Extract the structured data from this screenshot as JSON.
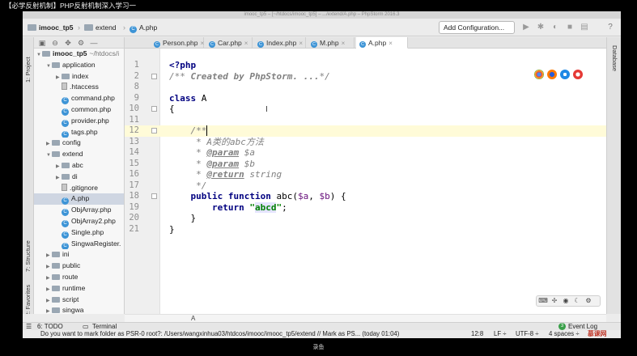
{
  "video": {
    "title": "【必学反射机制】PHP反射机制深入学习一",
    "watermark": "录鱼"
  },
  "window": {
    "mac_title": "imooc_tp5 – [~/htdocs/imooc_tp5] – .../extend/A.php – PhpStorm 2016.3"
  },
  "navbar": {
    "crumbs": [
      "imooc_tp5",
      "extend",
      "A.php"
    ],
    "run_config": "Add Configuration..."
  },
  "side_tabs": {
    "project": "1: Project",
    "structure": "7: Structure",
    "favorites": "2: Favorites",
    "database": "Database"
  },
  "project_tree": [
    {
      "indent": 0,
      "arrow": "▼",
      "icon": "folder",
      "label": "imooc_tp5",
      "suffix": "~/htdocs/i"
    },
    {
      "indent": 1,
      "arrow": "▼",
      "icon": "folder",
      "label": "application",
      "suffix": ""
    },
    {
      "indent": 2,
      "arrow": "▶",
      "icon": "folder",
      "label": "index",
      "suffix": ""
    },
    {
      "indent": 2,
      "arrow": "",
      "icon": "file",
      "label": ".htaccess",
      "suffix": ""
    },
    {
      "indent": 2,
      "arrow": "",
      "icon": "php",
      "label": "command.php",
      "suffix": ""
    },
    {
      "indent": 2,
      "arrow": "",
      "icon": "php",
      "label": "common.php",
      "suffix": ""
    },
    {
      "indent": 2,
      "arrow": "",
      "icon": "php",
      "label": "provider.php",
      "suffix": ""
    },
    {
      "indent": 2,
      "arrow": "",
      "icon": "php",
      "label": "tags.php",
      "suffix": ""
    },
    {
      "indent": 1,
      "arrow": "▶",
      "icon": "folder",
      "label": "config",
      "suffix": ""
    },
    {
      "indent": 1,
      "arrow": "▼",
      "icon": "folder",
      "label": "extend",
      "suffix": ""
    },
    {
      "indent": 2,
      "arrow": "▶",
      "icon": "folder",
      "label": "abc",
      "suffix": ""
    },
    {
      "indent": 2,
      "arrow": "▶",
      "icon": "folder",
      "label": "di",
      "suffix": ""
    },
    {
      "indent": 2,
      "arrow": "",
      "icon": "file",
      "label": ".gitignore",
      "suffix": ""
    },
    {
      "indent": 2,
      "arrow": "",
      "icon": "php",
      "label": "A.php",
      "suffix": "",
      "selected": true
    },
    {
      "indent": 2,
      "arrow": "",
      "icon": "php",
      "label": "ObjArray.php",
      "suffix": ""
    },
    {
      "indent": 2,
      "arrow": "",
      "icon": "php",
      "label": "ObjArray2.php",
      "suffix": ""
    },
    {
      "indent": 2,
      "arrow": "",
      "icon": "php",
      "label": "Single.php",
      "suffix": ""
    },
    {
      "indent": 2,
      "arrow": "",
      "icon": "php",
      "label": "SingwaRegister.",
      "suffix": ""
    },
    {
      "indent": 1,
      "arrow": "▶",
      "icon": "folder",
      "label": "ini",
      "suffix": ""
    },
    {
      "indent": 1,
      "arrow": "▶",
      "icon": "folder",
      "label": "public",
      "suffix": ""
    },
    {
      "indent": 1,
      "arrow": "▶",
      "icon": "folder",
      "label": "route",
      "suffix": ""
    },
    {
      "indent": 1,
      "arrow": "▶",
      "icon": "folder",
      "label": "runtime",
      "suffix": ""
    },
    {
      "indent": 1,
      "arrow": "▶",
      "icon": "folder",
      "label": "script",
      "suffix": ""
    },
    {
      "indent": 1,
      "arrow": "▶",
      "icon": "folder",
      "label": "singwa",
      "suffix": ""
    }
  ],
  "editor_tabs": [
    {
      "label": "Person.php",
      "active": false
    },
    {
      "label": "Car.php",
      "active": false
    },
    {
      "label": "Index.php",
      "active": false
    },
    {
      "label": "M.php",
      "active": false
    },
    {
      "label": "A.php",
      "active": true
    }
  ],
  "code_lines": [
    {
      "num": "1",
      "parts": [
        {
          "t": "<?php",
          "c": "kw"
        }
      ]
    },
    {
      "num": "2",
      "parts": [
        {
          "t": "/** ",
          "c": "cm"
        },
        {
          "t": "Created by PhpStorm. ...",
          "c": "cmb"
        },
        {
          "t": "*/",
          "c": "cm"
        }
      ]
    },
    {
      "num": "8",
      "parts": []
    },
    {
      "num": "9",
      "parts": [
        {
          "t": "class",
          "c": "kw"
        },
        {
          "t": " A",
          "c": ""
        }
      ]
    },
    {
      "num": "10",
      "parts": [
        {
          "t": "{",
          "c": ""
        }
      ]
    },
    {
      "num": "11",
      "parts": []
    },
    {
      "num": "12",
      "parts": [
        {
          "t": "    /**",
          "c": "cm"
        }
      ],
      "highlight": true
    },
    {
      "num": "13",
      "parts": [
        {
          "t": "     * A类的abc方法",
          "c": "cm"
        }
      ]
    },
    {
      "num": "14",
      "parts": [
        {
          "t": "     * ",
          "c": "cm"
        },
        {
          "t": "@param",
          "c": "doctag"
        },
        {
          "t": " $a",
          "c": "cm"
        }
      ]
    },
    {
      "num": "15",
      "parts": [
        {
          "t": "     * ",
          "c": "cm"
        },
        {
          "t": "@param",
          "c": "doctag"
        },
        {
          "t": " $b",
          "c": "cm"
        }
      ]
    },
    {
      "num": "16",
      "parts": [
        {
          "t": "     * ",
          "c": "cm"
        },
        {
          "t": "@return",
          "c": "doctag"
        },
        {
          "t": " string",
          "c": "cm"
        }
      ]
    },
    {
      "num": "17",
      "parts": [
        {
          "t": "     */",
          "c": "cm"
        }
      ]
    },
    {
      "num": "18",
      "parts": [
        {
          "t": "    ",
          "c": ""
        },
        {
          "t": "public function",
          "c": "kw"
        },
        {
          "t": " abc(",
          "c": ""
        },
        {
          "t": "$a",
          "c": "var"
        },
        {
          "t": ", ",
          "c": ""
        },
        {
          "t": "$b",
          "c": "var"
        },
        {
          "t": ") {",
          "c": ""
        }
      ]
    },
    {
      "num": "19",
      "parts": [
        {
          "t": "        ",
          "c": ""
        },
        {
          "t": "return",
          "c": "kw"
        },
        {
          "t": " ",
          "c": ""
        },
        {
          "t": "\"",
          "c": "str"
        },
        {
          "t": "abcd",
          "c": "strhl"
        },
        {
          "t": "\"",
          "c": "str"
        },
        {
          "t": ";",
          "c": ""
        }
      ]
    },
    {
      "num": "20",
      "parts": [
        {
          "t": "    }",
          "c": ""
        }
      ]
    },
    {
      "num": "21",
      "parts": [
        {
          "t": "}",
          "c": ""
        }
      ]
    }
  ],
  "editor_breadcrumb": "A",
  "bottom_tools": {
    "todo": "6: TODO",
    "terminal": "Terminal",
    "event_log": "Event Log",
    "event_count": "3"
  },
  "status": {
    "message": "Do you want to mark folder as PSR-0 root?: /Users/wangxinhua03/htdcos/imooc/imooc_tp5/extend // Mark as PS... (today 01:04)",
    "position": "12:8",
    "line_sep": "LF ÷",
    "encoding": "UTF-8 ÷",
    "indent": "4 spaces ÷",
    "logo": "慕课网"
  },
  "colors": {
    "keyword": "#000080",
    "comment": "#808080",
    "string": "#008000",
    "variable": "#660e7a",
    "current_line": "#fffbd8"
  }
}
